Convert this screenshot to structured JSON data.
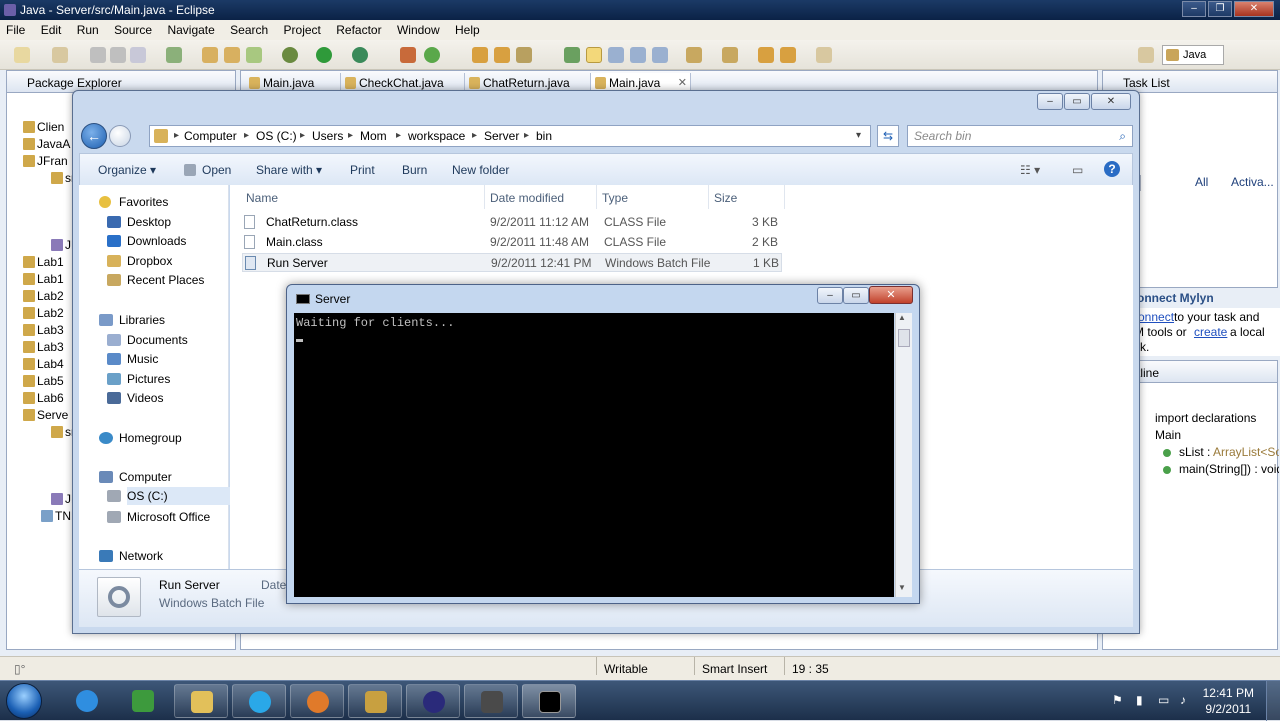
{
  "eclipse": {
    "title": "Java - Server/src/Main.java - Eclipse",
    "menu": [
      "File",
      "Edit",
      "Run",
      "Source",
      "Navigate",
      "Search",
      "Project",
      "Refactor",
      "Window",
      "Help"
    ],
    "perspective": "Java",
    "package_explorer": {
      "tab": "Package Explorer",
      "items": [
        "Clien",
        "JavaA",
        "JFran",
        "sr",
        "JR",
        "Lab1",
        "Lab1",
        "Lab2",
        "Lab2",
        "Lab3",
        "Lab3",
        "Lab4",
        "Lab5",
        "Lab6",
        "Serve",
        "sr",
        "JR",
        "TNB"
      ]
    },
    "editor_tabs": [
      "Main.java",
      "CheckChat.java",
      "ChatReturn.java",
      "Main.java"
    ],
    "task_list": {
      "tab": "Task List",
      "filter_all": "All",
      "filter_activate": "Activa..."
    },
    "mylyn": {
      "title": "onnect Mylyn",
      "line1_link": "onnect",
      "line1_rest": "to your task and",
      "line2_pre": "M tools or",
      "line2_link": "create",
      "line2_post": "a local",
      "line3": "sk."
    },
    "outline": {
      "tab": "tline",
      "items": [
        "import declarations",
        "Main",
        "sList : ArrayList<Soc",
        "main(String[]) : void"
      ],
      "sList_name": "sList : ",
      "sList_type": "ArrayList<Soc"
    },
    "status": {
      "writable": "Writable",
      "insert_mode": "Smart Insert",
      "position": "19 : 35"
    }
  },
  "explorer": {
    "breadcrumb": [
      "Computer",
      "OS (C:)",
      "Users",
      "Mom",
      "workspace",
      "Server",
      "bin"
    ],
    "search_placeholder": "Search bin",
    "commands": [
      "Organize ▾",
      "Open",
      "Share with ▾",
      "Print",
      "Burn",
      "New folder"
    ],
    "nav": {
      "favorites": "Favorites",
      "favorites_items": [
        "Desktop",
        "Downloads",
        "Dropbox",
        "Recent Places"
      ],
      "libraries": "Libraries",
      "libraries_items": [
        "Documents",
        "Music",
        "Pictures",
        "Videos"
      ],
      "homegroup": "Homegroup",
      "computer": "Computer",
      "computer_items": [
        "OS (C:)",
        "Microsoft Office"
      ],
      "network": "Network"
    },
    "columns": [
      "Name",
      "Date modified",
      "Type",
      "Size"
    ],
    "files": [
      {
        "name": "ChatReturn.class",
        "date": "9/2/2011 11:12 AM",
        "type": "CLASS File",
        "size": "3 KB"
      },
      {
        "name": "Main.class",
        "date": "9/2/2011 11:48 AM",
        "type": "CLASS File",
        "size": "2 KB"
      },
      {
        "name": "Run Server",
        "date": "9/2/2011 12:41 PM",
        "type": "Windows Batch File",
        "size": "1 KB"
      }
    ],
    "details": {
      "name": "Run Server",
      "type": "Windows Batch File",
      "date_label": "Date"
    }
  },
  "console": {
    "title": "Server",
    "output": "Waiting for clients..."
  },
  "taskbar": {
    "time": "12:41 PM",
    "date": "9/2/2011",
    "apps": [
      "ie-icon",
      "visual-studio-icon",
      "explorer-folder-icon",
      "skype-icon",
      "firefox-icon",
      "tool-icon",
      "eclipse-icon",
      "hypercam-icon",
      "cmd-icon"
    ]
  },
  "colors": {
    "accent_blue": "#1e5fb4",
    "console_bg": "#000000",
    "link": "#1f4fbf"
  }
}
